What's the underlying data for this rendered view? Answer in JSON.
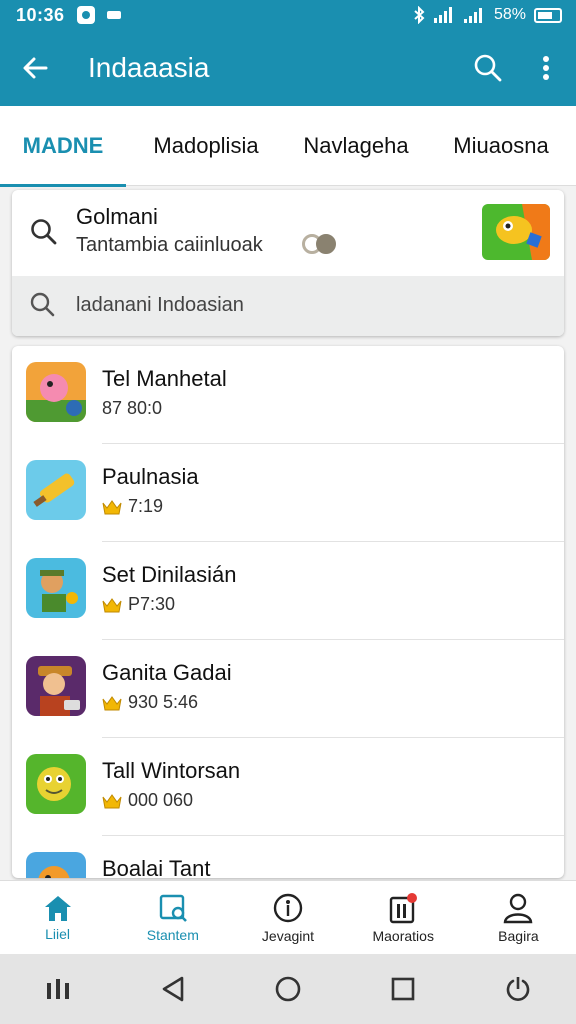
{
  "status_bar": {
    "time": "10:36",
    "battery": "58%"
  },
  "app_bar": {
    "title": "Indaaasia",
    "back_icon": "arrow-left-icon",
    "search_icon": "search-icon",
    "menu_icon": "more-vert-icon"
  },
  "tabs": [
    {
      "label": "MADNE",
      "active": true
    },
    {
      "label": "Madoplisia",
      "active": false
    },
    {
      "label": "Navlageha",
      "active": false
    },
    {
      "label": "Miuaosna",
      "active": false
    }
  ],
  "search_card": {
    "title": "Golmani",
    "subtitle": "Tantambia caiinluoak",
    "search_placeholder": "ladanani Indoasian"
  },
  "games": [
    {
      "name": "Tel Manhetal",
      "meta": "87 80:0",
      "crown": false
    },
    {
      "name": "Paulnasia",
      "meta": "7:19",
      "crown": true
    },
    {
      "name": "Set Dinilasián",
      "meta": "P7:30",
      "crown": true
    },
    {
      "name": "Ganita Gadai",
      "meta": "930 5:46",
      "crown": true
    },
    {
      "name": "Tall Wintorsan",
      "meta": "000 060",
      "crown": true
    },
    {
      "name": "Boalai Tant",
      "meta": "",
      "crown": false
    }
  ],
  "bottom_nav": [
    {
      "label": "Liiel",
      "icon": "home-icon",
      "active": true
    },
    {
      "label": "Stantem",
      "icon": "image-search-icon",
      "active": false
    },
    {
      "label": "Jevagint",
      "icon": "info-circle-icon",
      "active": false
    },
    {
      "label": "Maoratios",
      "icon": "notification-box-icon",
      "active": false
    },
    {
      "label": "Bagira",
      "icon": "person-icon",
      "active": false
    }
  ],
  "colors": {
    "accent": "#1a8fb0",
    "crown": "#f2b705"
  }
}
